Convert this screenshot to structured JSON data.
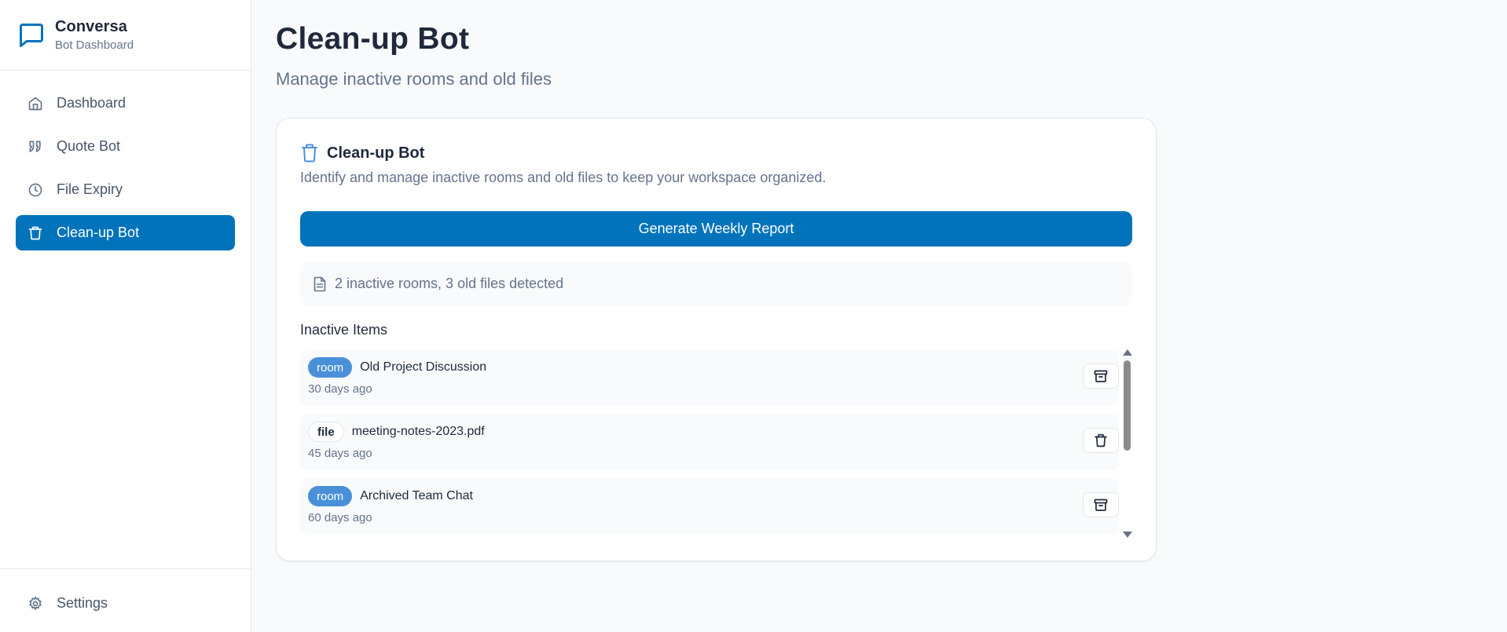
{
  "brand": {
    "name": "Conversa",
    "subtitle": "Bot Dashboard",
    "icon": "message-square-icon",
    "accent": "#0073bb"
  },
  "sidebar": {
    "items": [
      {
        "label": "Dashboard",
        "icon": "home-icon",
        "active": false
      },
      {
        "label": "Quote Bot",
        "icon": "quote-icon",
        "active": false
      },
      {
        "label": "File Expiry",
        "icon": "clock-icon",
        "active": false
      },
      {
        "label": "Clean-up Bot",
        "icon": "trash-icon",
        "active": true
      }
    ],
    "footer": {
      "label": "Settings",
      "icon": "gear-icon"
    }
  },
  "page": {
    "title": "Clean-up Bot",
    "subtitle": "Manage inactive rooms and old files"
  },
  "card": {
    "title": "Clean-up Bot",
    "description": "Identify and manage inactive rooms and old files to keep your workspace organized.",
    "button_label": "Generate Weekly Report",
    "summary": "2 inactive rooms, 3 old files detected",
    "section_label": "Inactive Items",
    "items": [
      {
        "type": "room",
        "name": "Old Project Discussion",
        "age": "30 days ago",
        "action": "archive-icon"
      },
      {
        "type": "file",
        "name": "meeting-notes-2023.pdf",
        "age": "45 days ago",
        "action": "trash-icon"
      },
      {
        "type": "room",
        "name": "Archived Team Chat",
        "age": "60 days ago",
        "action": "archive-icon"
      }
    ]
  },
  "colors": {
    "primary": "#0073bb",
    "room_badge": "#4a90d9",
    "muted_text": "#64748b",
    "background": "#f8fafc"
  }
}
